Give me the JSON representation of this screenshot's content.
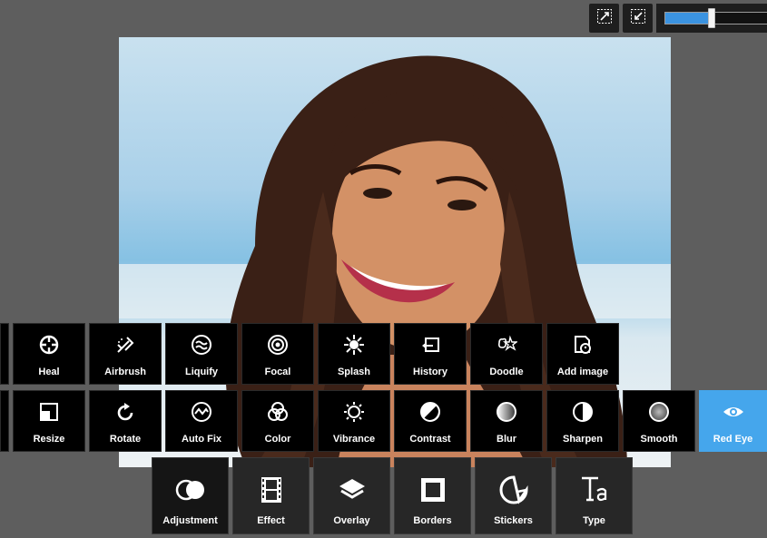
{
  "colors": {
    "background": "#5e5e5e",
    "tile": "#000000",
    "active": "#45a6ec",
    "category_bar": "#272727",
    "zoom_fill": "#3b93e0"
  },
  "toolbar": {
    "fit_icon": "expand-arrow-icon",
    "actual_size_icon": "fit-arrow-icon",
    "zoom_level": 0.43
  },
  "photo": {
    "subject": "smiling woman portrait"
  },
  "tools_row1": [
    {
      "label": "Heal",
      "icon": "heal-crosshair-icon"
    },
    {
      "label": "Airbrush",
      "icon": "airbrush-icon"
    },
    {
      "label": "Liquify",
      "icon": "liquify-waves-icon"
    },
    {
      "label": "Focal",
      "icon": "focal-target-icon"
    },
    {
      "label": "Splash",
      "icon": "splash-icon"
    },
    {
      "label": "History",
      "icon": "history-icon"
    },
    {
      "label": "Doodle",
      "icon": "doodle-icon"
    },
    {
      "label": "Add image",
      "icon": "add-image-icon"
    }
  ],
  "tools_row2": [
    {
      "label": "Resize",
      "icon": "resize-icon"
    },
    {
      "label": "Rotate",
      "icon": "rotate-icon"
    },
    {
      "label": "Auto Fix",
      "icon": "auto-fix-icon"
    },
    {
      "label": "Color",
      "icon": "color-circles-icon"
    },
    {
      "label": "Vibrance",
      "icon": "vibrance-sun-icon"
    },
    {
      "label": "Contrast",
      "icon": "contrast-icon"
    },
    {
      "label": "Blur",
      "icon": "blur-icon"
    },
    {
      "label": "Sharpen",
      "icon": "sharpen-icon"
    },
    {
      "label": "Smooth",
      "icon": "smooth-icon"
    },
    {
      "label": "Red Eye",
      "icon": "eye-icon",
      "active": true
    }
  ],
  "categories": [
    {
      "label": "Adjustment",
      "icon": "adjustment-circles-icon",
      "active": true
    },
    {
      "label": "Effect",
      "icon": "film-strip-icon"
    },
    {
      "label": "Overlay",
      "icon": "layers-icon"
    },
    {
      "label": "Borders",
      "icon": "border-frame-icon"
    },
    {
      "label": "Stickers",
      "icon": "sticker-icon"
    },
    {
      "label": "Type",
      "icon": "type-icon"
    }
  ]
}
